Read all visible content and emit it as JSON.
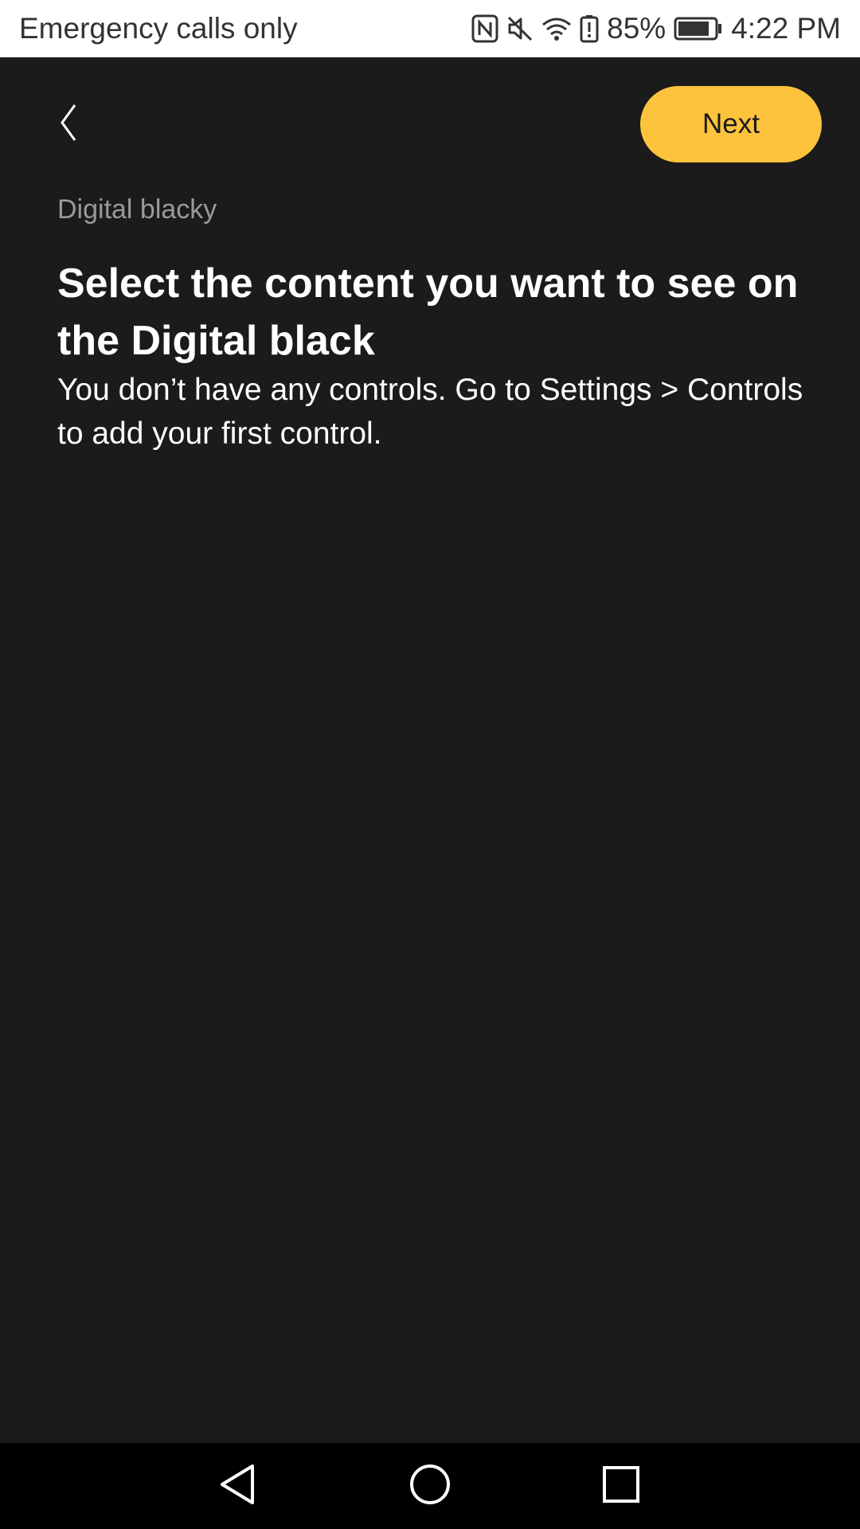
{
  "status_bar": {
    "carrier_text": "Emergency calls only",
    "battery_percent": "85%",
    "time": "4:22 PM",
    "icons": [
      "nfc-icon",
      "mute-icon",
      "wifi-icon",
      "battery-alert-icon",
      "battery-icon"
    ]
  },
  "header": {
    "back_icon": "chevron-left-icon",
    "next_label": "Next"
  },
  "content": {
    "section_label": "Digital blacky",
    "title": "Select the content you want to see on the Digital black",
    "description": "You don’t have any controls. Go to Settings > Controls to add your first control."
  },
  "nav_bar": {
    "icons": [
      "back-triangle-icon",
      "home-circle-icon",
      "recents-square-icon"
    ]
  },
  "colors": {
    "background": "#1b1b1b",
    "accent": "#fdc33c",
    "status_bar_bg": "#ffffff",
    "nav_bar_bg": "#000000"
  }
}
